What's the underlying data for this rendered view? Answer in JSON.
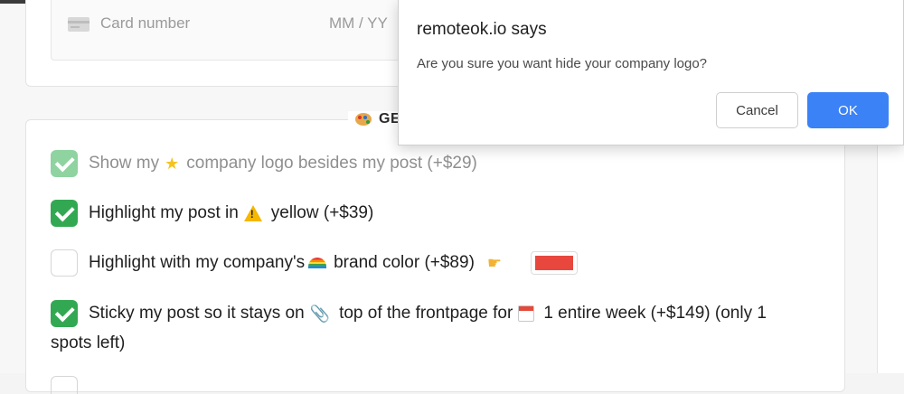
{
  "payment": {
    "card_number_placeholder": "Card number",
    "expiry_placeholder": "MM / YY"
  },
  "options_section": {
    "title_visible": "GE",
    "items": [
      {
        "checked": true,
        "muted": true,
        "text_before": "Show my",
        "icon": "star-icon",
        "text_after": "company logo besides my post (+$29)"
      },
      {
        "checked": true,
        "text_before": "Highlight my post in",
        "icon": "warning-icon",
        "text_after": "yellow (+$39)"
      },
      {
        "checked": false,
        "text_before": "Highlight with my company's",
        "icon": "rainbow-icon",
        "text_after": "brand color (+$89)",
        "pointer_icon": "pointing-hand-icon",
        "swatch_color": "#e8473e"
      },
      {
        "checked": true,
        "text_before": "Sticky my post so it stays on",
        "icon": "paperclip-icon",
        "text_middle": "top of the frontpage for",
        "icon2": "calendar-icon",
        "text_after": "1 entire week (+$149) (only 1",
        "text_wrap": "spots left)"
      }
    ]
  },
  "dialog": {
    "title": "remoteok.io says",
    "message": "Are you sure you want hide your company logo?",
    "cancel_label": "Cancel",
    "ok_label": "OK"
  },
  "colors": {
    "check_green": "#33a853",
    "ok_blue": "#3b82f6",
    "swatch_red": "#e8473e"
  }
}
